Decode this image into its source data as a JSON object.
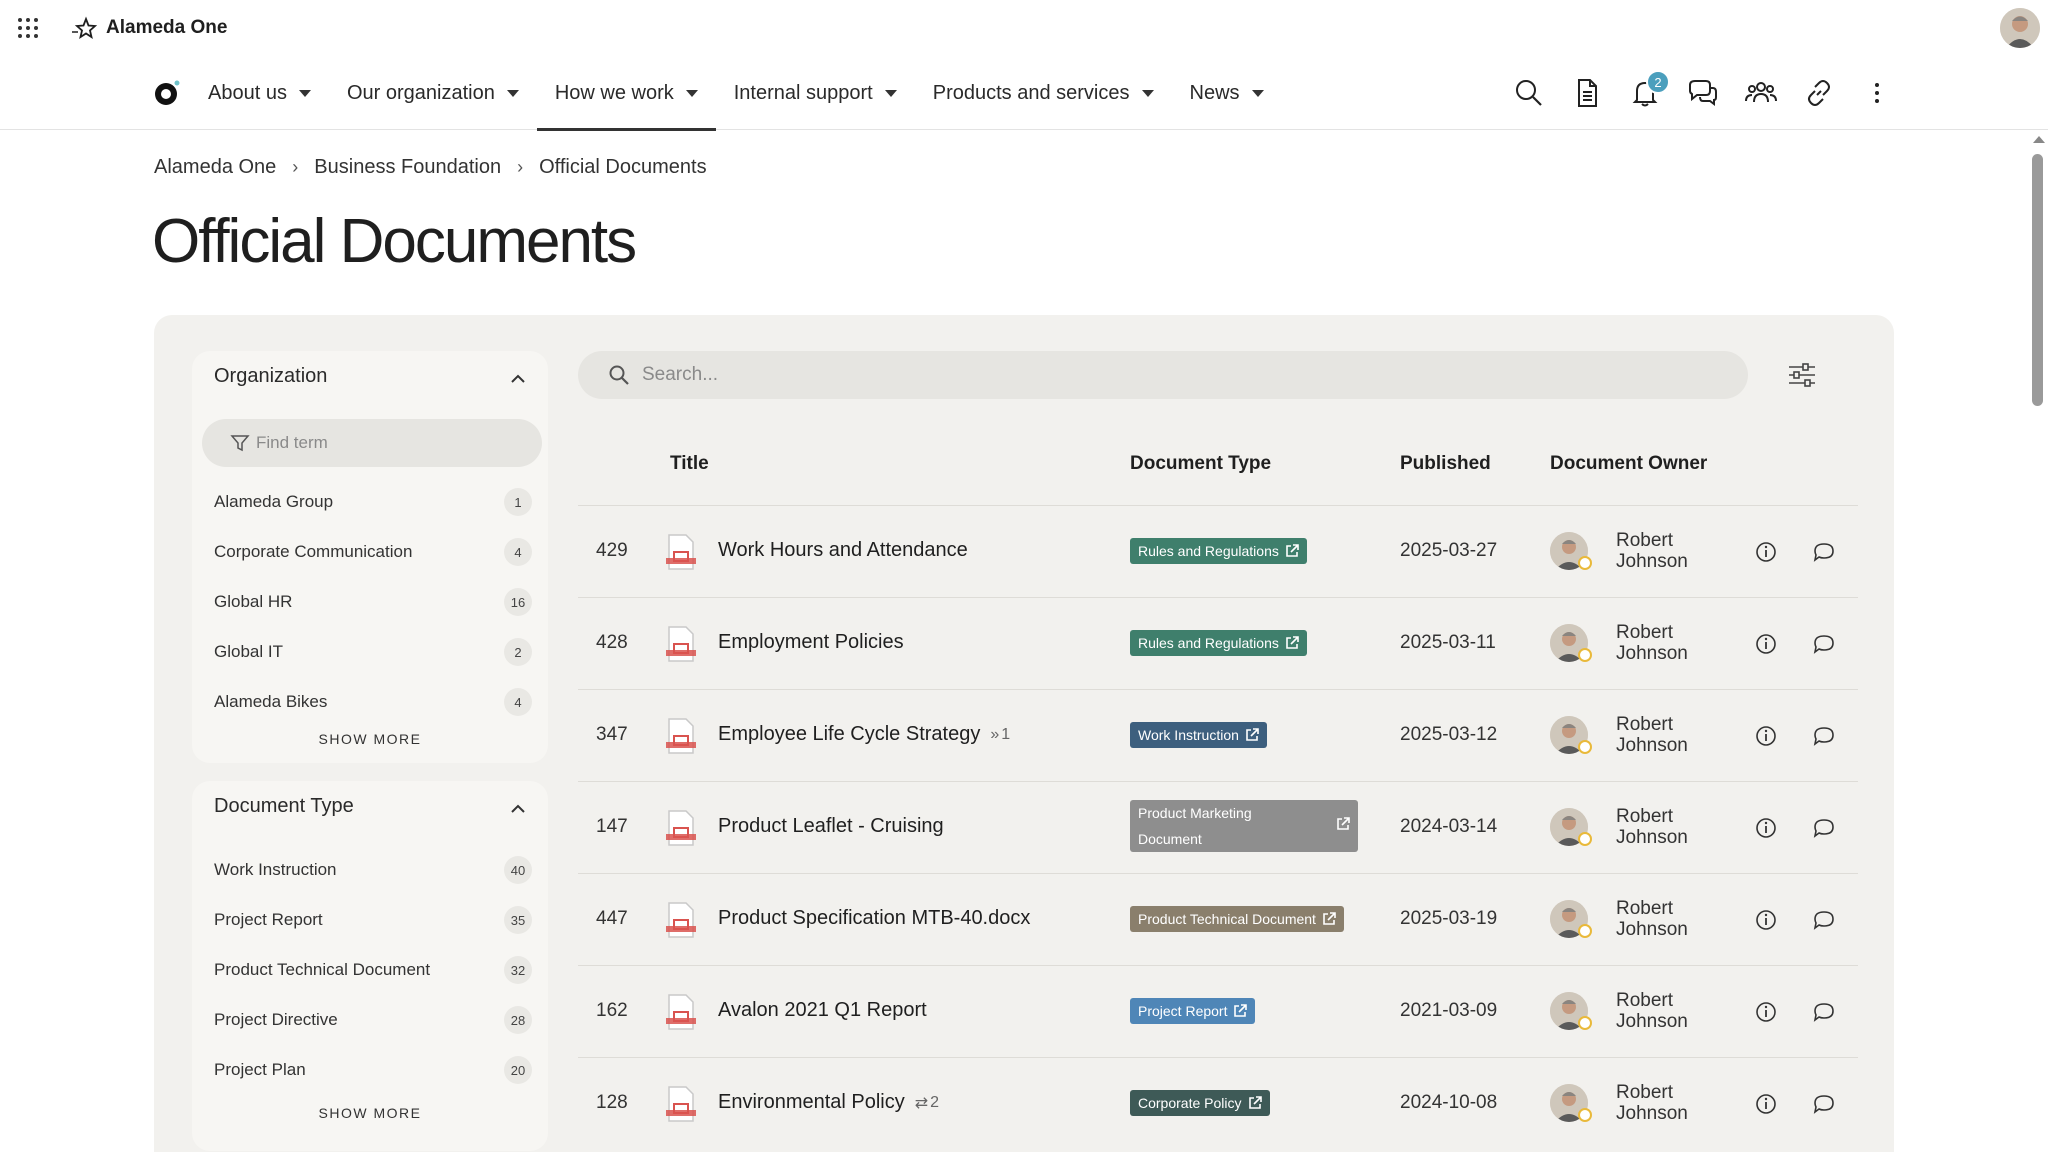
{
  "app": {
    "brand": "Alameda One"
  },
  "nav": {
    "items": [
      {
        "label": "About us"
      },
      {
        "label": "Our organization"
      },
      {
        "label": "How we work"
      },
      {
        "label": "Internal support"
      },
      {
        "label": "Products and services"
      },
      {
        "label": "News"
      }
    ],
    "active_item": "How we work",
    "notification_count": "2",
    "tools": [
      "search-icon",
      "document-icon",
      "bell-icon",
      "chat-icon",
      "people-icon",
      "link-icon",
      "more-vertical-icon"
    ]
  },
  "breadcrumb": [
    "Alameda One",
    "Business Foundation",
    "Official Documents"
  ],
  "page": {
    "title": "Official Documents"
  },
  "filters": {
    "organization": {
      "title": "Organization",
      "find_placeholder": "Find term",
      "terms": [
        {
          "label": "Alameda Group",
          "count": "1"
        },
        {
          "label": "Corporate Communication",
          "count": "4"
        },
        {
          "label": "Global HR",
          "count": "16"
        },
        {
          "label": "Global IT",
          "count": "2"
        },
        {
          "label": "Alameda Bikes",
          "count": "4"
        }
      ],
      "show_more": "SHOW MORE"
    },
    "document_type": {
      "title": "Document Type",
      "terms": [
        {
          "label": "Work Instruction",
          "count": "40"
        },
        {
          "label": "Project Report",
          "count": "35"
        },
        {
          "label": "Product Technical Document",
          "count": "32"
        },
        {
          "label": "Project Directive",
          "count": "28"
        },
        {
          "label": "Project Plan",
          "count": "20"
        }
      ],
      "show_more": "SHOW MORE"
    }
  },
  "search": {
    "placeholder": "Search..."
  },
  "table": {
    "headers": {
      "title": "Title",
      "doc_type": "Document Type",
      "published": "Published",
      "owner": "Document Owner"
    },
    "rows": [
      {
        "id": "429",
        "title": "Work Hours and Attendance",
        "extra": "",
        "doc_type": "Rules and Regulations",
        "published": "2025-03-27",
        "owner_first": "Robert",
        "owner_last": "Johnson"
      },
      {
        "id": "428",
        "title": "Employment Policies",
        "extra": "",
        "doc_type": "Rules and Regulations",
        "published": "2025-03-11",
        "owner_first": "Robert",
        "owner_last": "Johnson"
      },
      {
        "id": "347",
        "title": "Employee Life Cycle Strategy",
        "extra": "1",
        "doc_type": "Work Instruction",
        "published": "2025-03-12",
        "owner_first": "Robert",
        "owner_last": "Johnson"
      },
      {
        "id": "147",
        "title": "Product Leaflet - Cruising",
        "extra": "",
        "doc_type_line1": "Product Marketing",
        "doc_type_line2": "Document",
        "published": "2024-03-14",
        "owner_first": "Robert",
        "owner_last": "Johnson"
      },
      {
        "id": "447",
        "title": "Product Specification MTB-40.docx",
        "extra": "",
        "doc_type": "Product Technical Document",
        "published": "2025-03-19",
        "owner_first": "Robert",
        "owner_last": "Johnson"
      },
      {
        "id": "162",
        "title": "Avalon 2021 Q1 Report",
        "extra": "",
        "doc_type": "Project Report",
        "published": "2021-03-09",
        "owner_first": "Robert",
        "owner_last": "Johnson"
      },
      {
        "id": "128",
        "title": "Environmental Policy",
        "extra": "2",
        "doc_type": "Corporate Policy",
        "published": "2024-10-08",
        "owner_first": "Robert",
        "owner_last": "Johnson"
      }
    ]
  },
  "colors": {
    "rules_and_regulations": "#3f7f6c",
    "work_instruction": "#3d5f7e",
    "product_marketing_document": "#8e8e8e",
    "product_technical_document": "#8a7f6c",
    "project_report": "#4f86b7",
    "corporate_policy": "#3e5a57",
    "notification_badge": "#4b9fbd"
  }
}
